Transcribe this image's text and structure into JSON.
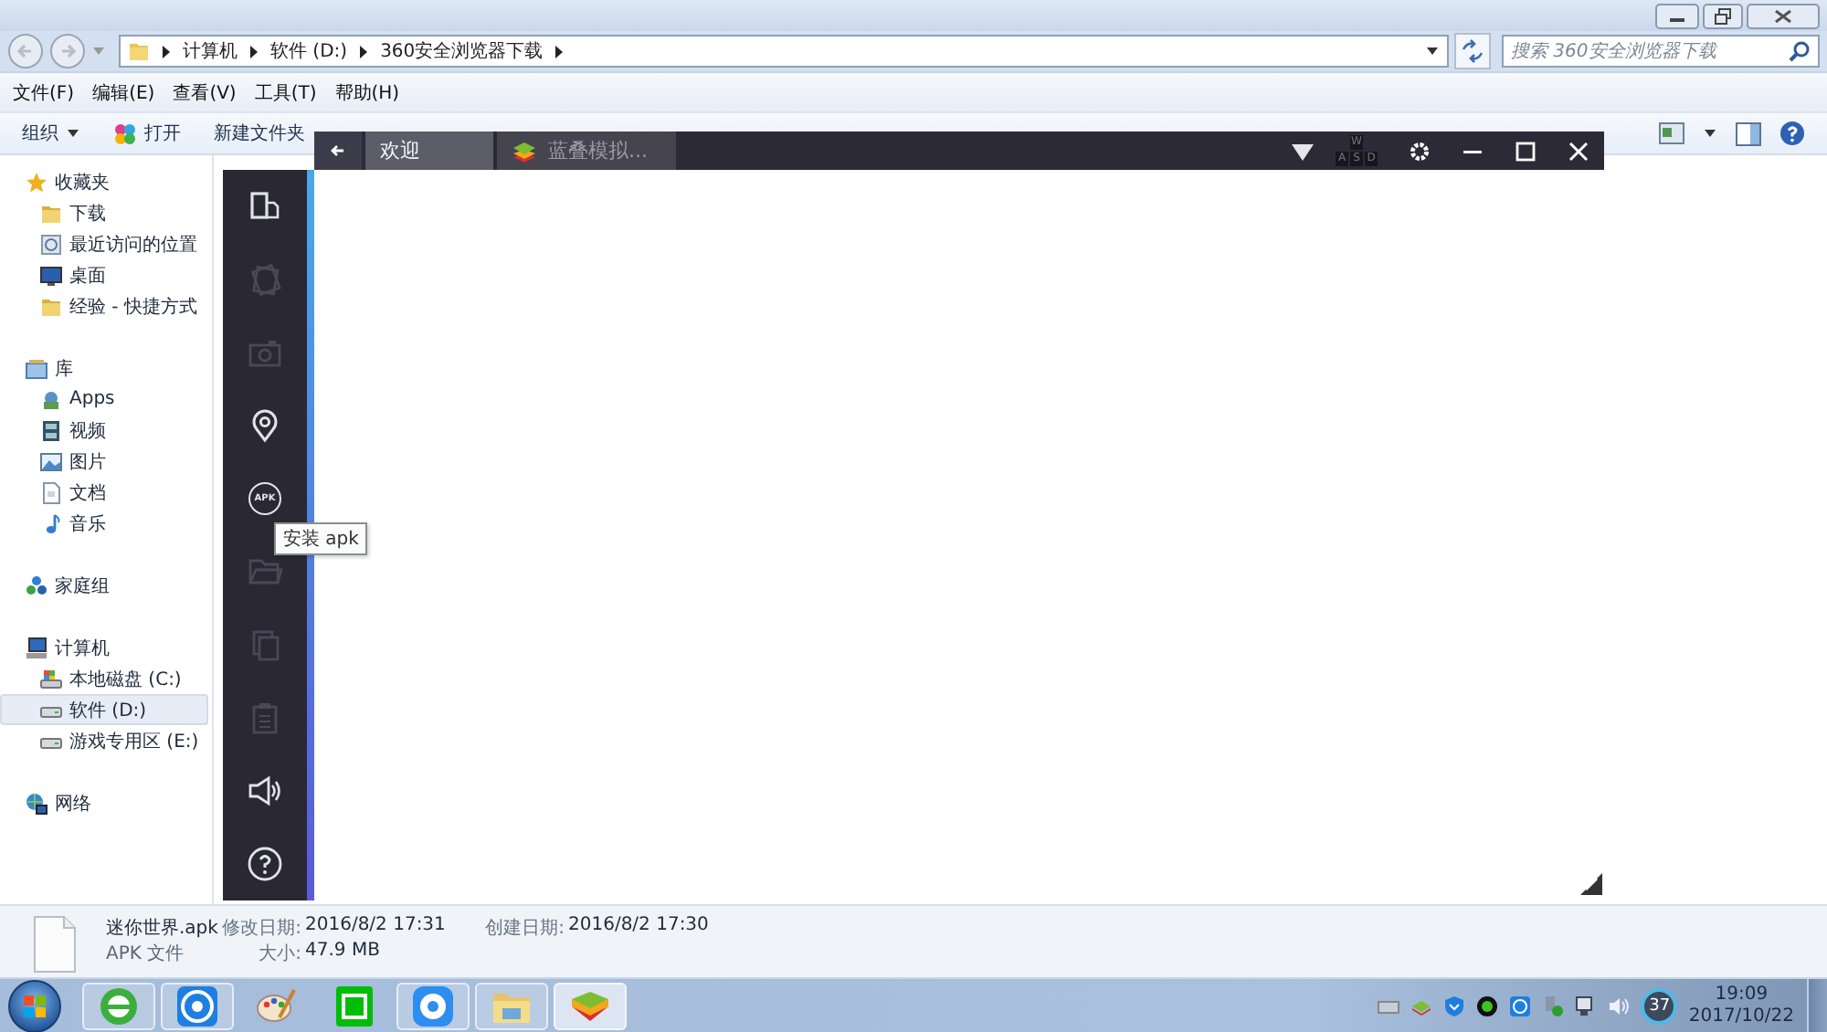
{
  "explorer": {
    "address": {
      "crumbs": [
        "计算机",
        "软件 (D:)",
        "360安全浏览器下载"
      ]
    },
    "search": {
      "placeholder": "搜索 360安全浏览器下载"
    },
    "menu": [
      "文件(F)",
      "编辑(E)",
      "查看(V)",
      "工具(T)",
      "帮助(H)"
    ],
    "toolbar": [
      {
        "label": "组织",
        "kind": "menu"
      },
      {
        "label": "打开",
        "kind": "open"
      },
      {
        "label": "新建文件夹",
        "kind": "plain"
      }
    ],
    "nav": [
      {
        "label": "收藏夹",
        "selected": false,
        "children": [
          {
            "label": "下载",
            "selected": false
          },
          {
            "label": "最近访问的位置",
            "selected": false
          },
          {
            "label": "桌面",
            "selected": false
          },
          {
            "label": "经验 - 快捷方式",
            "selected": false
          }
        ]
      },
      {
        "label": "库",
        "selected": false,
        "children": [
          {
            "label": "Apps",
            "selected": false
          },
          {
            "label": "视频",
            "selected": false
          },
          {
            "label": "图片",
            "selected": false
          },
          {
            "label": "文档",
            "selected": false
          },
          {
            "label": "音乐",
            "selected": false
          }
        ]
      },
      {
        "label": "家庭组",
        "selected": false
      },
      {
        "label": "计算机",
        "selected": false,
        "children": [
          {
            "label": "本地磁盘 (C:)",
            "selected": false
          },
          {
            "label": "软件 (D:)",
            "selected": true
          },
          {
            "label": "游戏专用区 (E:)",
            "selected": false
          }
        ]
      },
      {
        "label": "网络",
        "selected": false
      }
    ],
    "details": {
      "name": "迷你世界.apk",
      "type": "APK 文件",
      "fields": [
        {
          "label": "修改日期:",
          "value": "2016/8/2 17:31"
        },
        {
          "label": "创建日期:",
          "value": "2016/8/2 17:30"
        },
        {
          "label": "大小:",
          "value": "47.9 MB"
        }
      ]
    }
  },
  "emulator": {
    "tabs": [
      {
        "label": "欢迎",
        "kind": "home",
        "selected": true
      },
      {
        "label": "蓝叠模拟...",
        "kind": "app",
        "selected": false
      }
    ],
    "keymap_keys": [
      "W",
      "A",
      "S",
      "D"
    ],
    "sidebar": [
      {
        "disabled": false
      },
      {
        "disabled": true
      },
      {
        "disabled": true
      },
      {
        "disabled": false
      },
      {
        "disabled": false,
        "label": "APK"
      },
      {
        "disabled": true
      },
      {
        "disabled": true
      },
      {
        "disabled": true
      },
      {
        "disabled": false
      },
      {
        "disabled": false
      }
    ],
    "tooltip": "安装 apk"
  },
  "taskbar": {
    "apps": [
      {
        "running": true,
        "selected": false
      },
      {
        "running": true,
        "selected": false
      },
      {
        "running": false,
        "selected": false
      },
      {
        "running": false,
        "selected": false
      },
      {
        "running": true,
        "selected": false
      },
      {
        "running": true,
        "selected": false
      },
      {
        "running": true,
        "selected": true
      }
    ],
    "tray_badge": "37",
    "time": "19:09",
    "date": "2017/10/22"
  }
}
